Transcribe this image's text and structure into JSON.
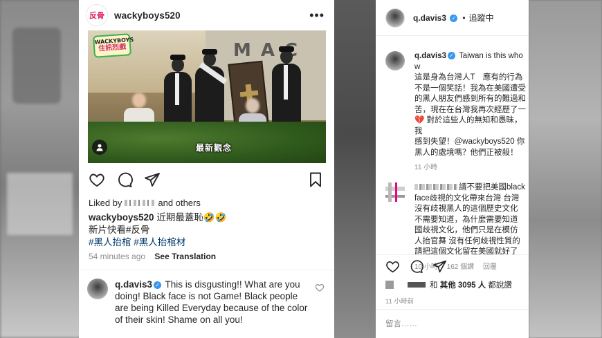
{
  "left_post": {
    "brand_logo_text": "反骨",
    "username": "wackyboys520",
    "image": {
      "badge_line1": "WACKYBOYS",
      "badge_line2": "住訊烈戲",
      "storefront_sign": "MAC",
      "overlay_caption": "最新觀念"
    },
    "liked_prefix": "Liked by",
    "liked_suffix": "and others",
    "caption_username": "wackyboys520",
    "caption_text": " 近期最蓋恥🤣🤣",
    "caption_line2": "新片快看#反骨",
    "hashtags": "#黑人抬棺 #黑人抬棺材",
    "time_ago": "54 minutes ago",
    "see_translation": "See Translation",
    "comment": {
      "username": "q.davis3",
      "text": "This is disgusting!! What are you doing! Black face is not Game! Black people are being Killed Everyday because of the color of their skin! Shame on all you!"
    }
  },
  "right_post": {
    "header_username": "q.davis3",
    "header_separator": "•",
    "header_follow": "追蹤中",
    "comment1": {
      "username": "q.davis3",
      "text": "Taiwan is this who w\n這是身為台灣人T　應有的行為\n不是一個笑話！我為在美國遭受\n的黑人朋友們感到所有的難過和\n苦，現在在台灣我再次經歷了一\n💔 對於這些人的無知和愚昧，我\n感到失望！@wackyboys520 你\n黑人的處境嗎？他們正被殺！",
      "time": "11 小時"
    },
    "comment2": {
      "text": "請不要把美國black\nface歧視的文化帶來台灣 台灣\n沒有歧視黑人的這個歷史文化\n不需要知道，為什麼需要知道\n國歧視文化，他們只是在模仿\n人抬官舞 沒有任何歧視性質的\n請把這個文化留在美國就好了",
      "time": "10 小時",
      "likes": "162 個讚",
      "reply": "回覆"
    },
    "likes_prefix": "和",
    "likes_bold": "其他 3095 人",
    "likes_suffix": "都說讚",
    "post_time": "11 小時前",
    "add_comment_placeholder": "留言……"
  }
}
